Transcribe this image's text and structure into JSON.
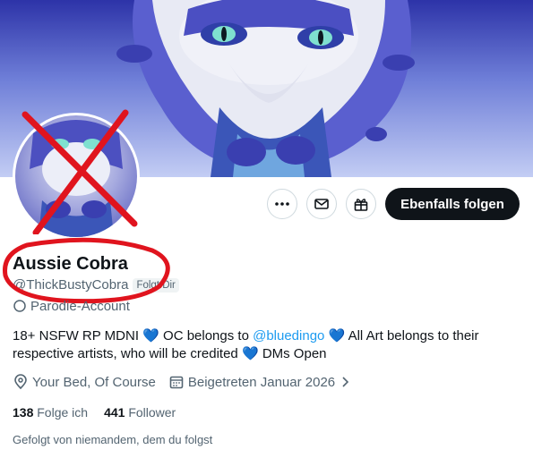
{
  "profile": {
    "name": "Aussie Cobra",
    "handle": "@ThickBustyCobra",
    "follows_you": "Folgt Dir",
    "parody_label": "Parodie-Account",
    "bio": {
      "part1": "18+ NSFW RP MDNI",
      "part2": "OC belongs to",
      "mention": "@bluedingo",
      "part3": "All Art belongs to their respective artists, who will be credited",
      "part4": "DMs Open"
    },
    "location": "Your Bed, Of Course",
    "joined": "Beigetreten Januar 2026"
  },
  "actions": {
    "follow_back": "Ebenfalls folgen"
  },
  "stats": {
    "following_count": "138",
    "following_label": "Folge ich",
    "followers_count": "441",
    "followers_label": "Follower"
  },
  "footer": {
    "followed_by": "Gefolgt von niemandem, dem du folgst"
  },
  "icons": {
    "more": "more-icon",
    "message": "mail-icon",
    "gift": "gift-icon",
    "location": "location-icon",
    "calendar": "calendar-icon",
    "chevron": "chevron-right-icon",
    "heart": "blue-heart-icon"
  },
  "colors": {
    "accent": "#1d9bf0",
    "button_dark": "#0f1419",
    "annotation_red": "#e0141e",
    "heart_blue": "#5aa9e6"
  }
}
